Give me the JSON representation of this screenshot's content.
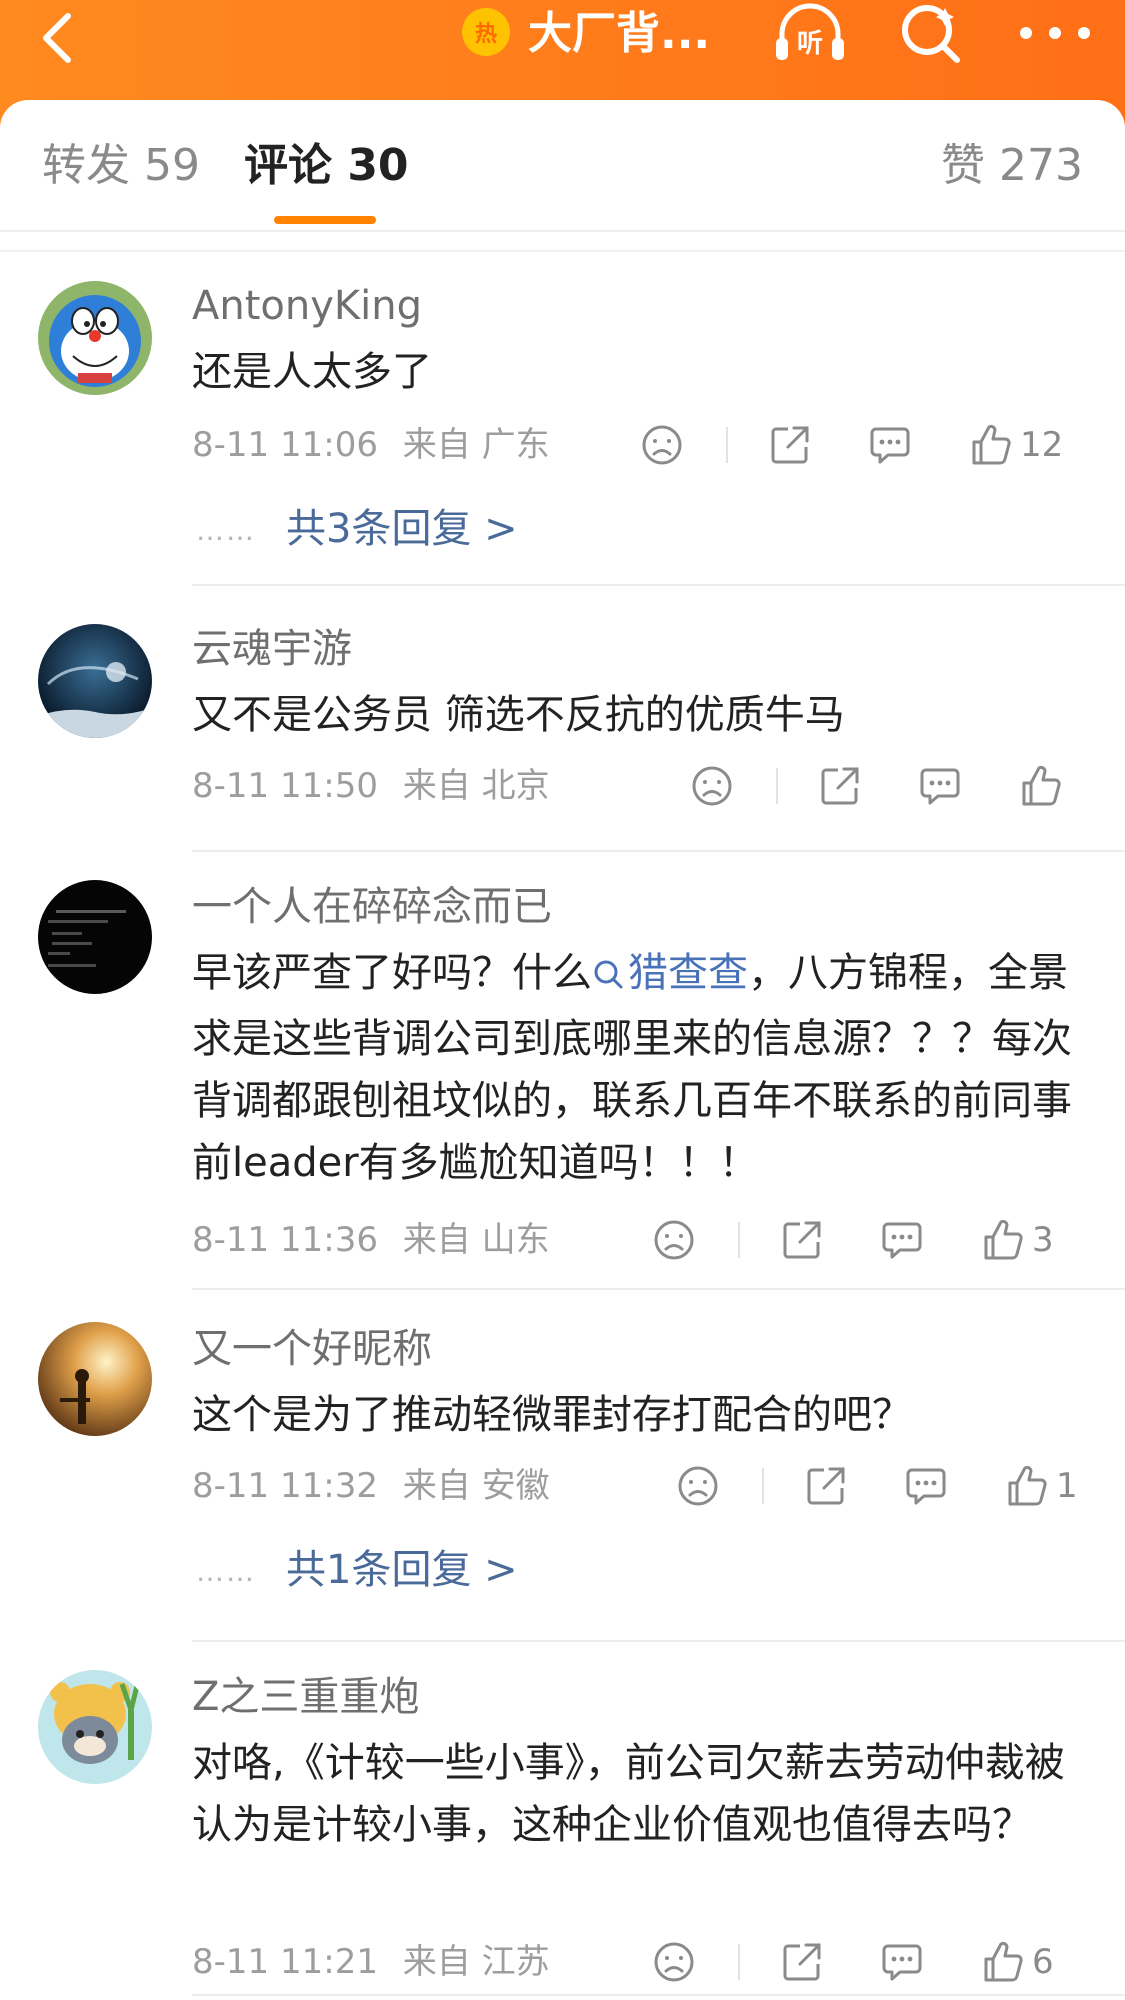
{
  "header": {
    "hot_badge": "热",
    "title": "大厂背...",
    "icons": [
      "back-arrow-icon",
      "listen-icon",
      "search-icon",
      "more-icon"
    ]
  },
  "tabs": {
    "repost": "转发 59",
    "comments": "评论 30",
    "likes": "赞 273"
  },
  "colors": {
    "accent": "#ff8200",
    "link": "#4a6a9a",
    "header": "#ff7a1a"
  },
  "comments": [
    {
      "user": "AntonyKing",
      "text": "还是人太多了",
      "time": "8-11 11:06",
      "location": "来自 广东",
      "likes": "12",
      "replies": "共3条回复 >",
      "dots": "……"
    },
    {
      "user": "云魂宇游",
      "text": "又不是公务员 筛选不反抗的优质牛马",
      "time": "8-11 11:50",
      "location": "来自 北京",
      "likes": ""
    },
    {
      "user": "一个人在碎碎念而已",
      "text_before": "早该严查了好吗？什么",
      "tag": "猎查查",
      "text_after": "，八方锦程，全景求是这些背调公司到底哪里来的信息源？？？每次背调都跟刨祖坟似的，联系几百年不联系的前同事前leader有多尴尬知道吗！！！",
      "time": "8-11 11:36",
      "location": "来自 山东",
      "likes": "3"
    },
    {
      "user": "又一个好昵称",
      "text": "这个是为了推动轻微罪封存打配合的吧？",
      "time": "8-11 11:32",
      "location": "来自 安徽",
      "likes": "1",
      "replies": "共1条回复 >",
      "dots": "……"
    },
    {
      "user": "Z之三重重炮",
      "text": "对咯,《计较一些小事》，前公司欠薪去劳动仲裁被认为是计较小事，这种企业价值观也值得去吗？",
      "time": "8-11 11:21",
      "location": "来自 江苏",
      "likes": "6"
    }
  ]
}
